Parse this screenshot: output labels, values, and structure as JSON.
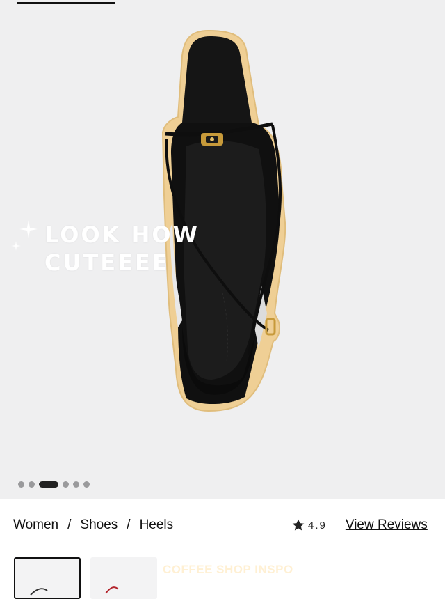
{
  "carousel": {
    "total_slides": 6,
    "active_slide": 3
  },
  "sticker": {
    "line1": "LOOK HOW",
    "line2": "CUTEEEE"
  },
  "breadcrumb": {
    "items": [
      "Women",
      "Shoes",
      "Heels"
    ],
    "separator": "/"
  },
  "rating": {
    "value": "4.9",
    "icon": "star-icon",
    "reviews_link": "View Reviews"
  },
  "thumbnails": {
    "count_visible": 2,
    "selected": 1
  },
  "watermark": "COFFEE SHOP INSPO",
  "colors": {
    "hero_bg": "#efeff0",
    "shoe": "#141414",
    "outline": "#e9cc95",
    "hardware": "#c79a3a",
    "text": "#111111"
  }
}
